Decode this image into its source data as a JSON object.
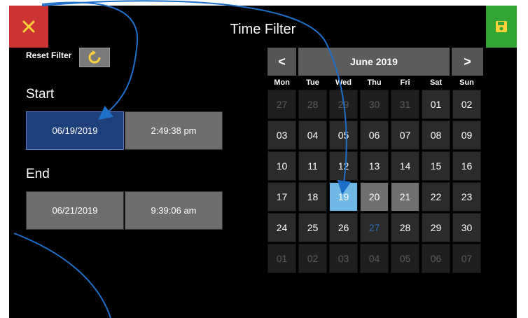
{
  "header": {
    "title": "Time Filter"
  },
  "filter": {
    "reset_label": "Reset Filter"
  },
  "start": {
    "label": "Start",
    "date": "06/19/2019",
    "time": "2:49:38 pm"
  },
  "end": {
    "label": "End",
    "date": "06/21/2019",
    "time": "9:39:06 am"
  },
  "calendar": {
    "month_label": "June 2019",
    "prev_label": "<",
    "next_label": ">",
    "weekdays": [
      "Mon",
      "Tue",
      "Wed",
      "Thu",
      "Fri",
      "Sat",
      "Sun"
    ],
    "weeks": [
      [
        "27",
        "28",
        "29",
        "30",
        "31",
        "01",
        "02"
      ],
      [
        "03",
        "04",
        "05",
        "06",
        "07",
        "08",
        "09"
      ],
      [
        "10",
        "11",
        "12",
        "13",
        "14",
        "15",
        "16"
      ],
      [
        "17",
        "18",
        "19",
        "20",
        "21",
        "22",
        "23"
      ],
      [
        "24",
        "25",
        "26",
        "27",
        "28",
        "29",
        "30"
      ],
      [
        "01",
        "02",
        "03",
        "04",
        "05",
        "06",
        "07"
      ]
    ]
  },
  "colors": {
    "close": "#cc3333",
    "save": "#33a535",
    "selected_day": "#6fb8e6",
    "active_field": "#1f3f7a",
    "annotation": "#1e6fc8"
  },
  "icons": {
    "close": "close-icon",
    "save": "save-icon",
    "reset": "refresh-icon",
    "prev": "chevron-left-icon",
    "next": "chevron-right-icon"
  }
}
